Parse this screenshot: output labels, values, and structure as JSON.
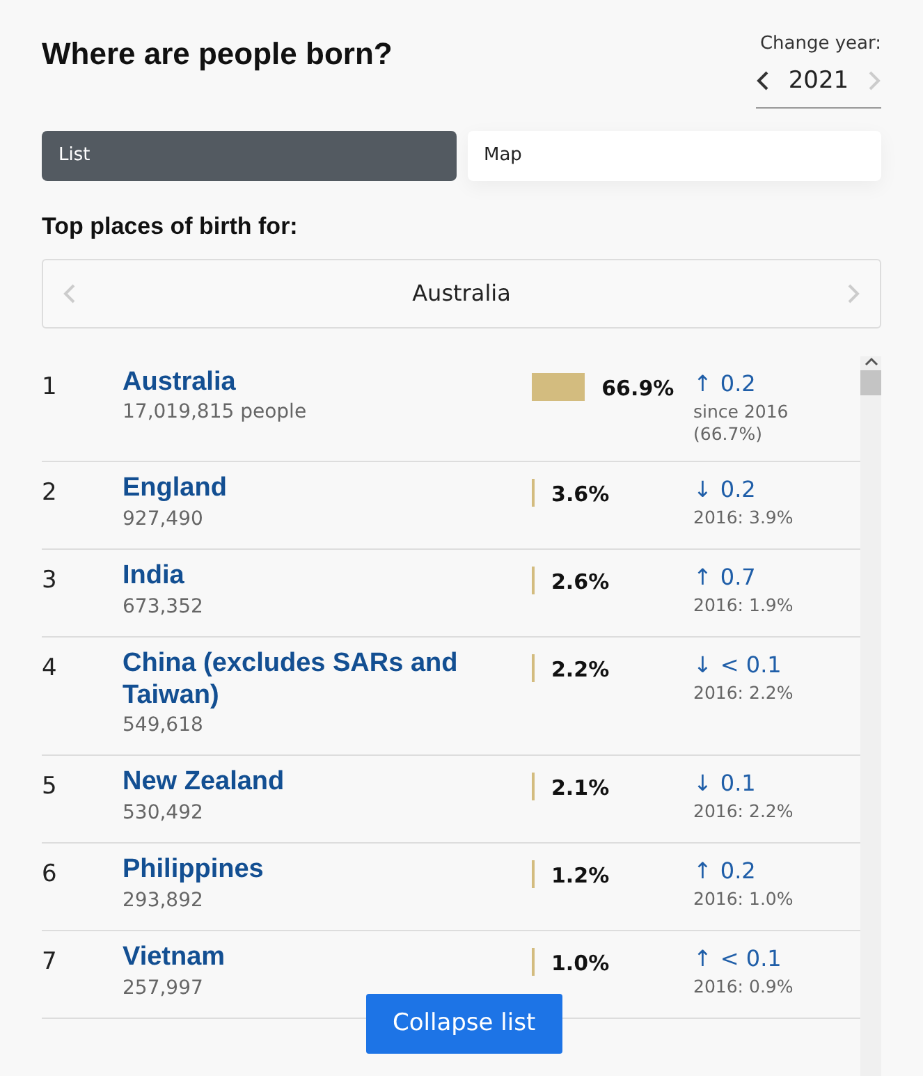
{
  "title": "Where are people born?",
  "year_picker": {
    "label": "Change year:",
    "value": "2021",
    "prev_enabled": true,
    "next_enabled": false
  },
  "tabs": [
    {
      "label": "List",
      "selected": true
    },
    {
      "label": "Map",
      "selected": false
    }
  ],
  "subtitle": "Top places of birth for:",
  "region_picker": {
    "value": "Australia",
    "prev_enabled": false,
    "next_enabled": false
  },
  "rows": [
    {
      "rank": "1",
      "name": "Australia",
      "count": "17,019,815 people",
      "share": "66.9%",
      "arrow": "↑",
      "change": "0.2",
      "previous": "since 2016 (66.7%)"
    },
    {
      "rank": "2",
      "name": "England",
      "count": "927,490",
      "share": "3.6%",
      "arrow": "↓",
      "change": "0.2",
      "previous": "2016: 3.9%"
    },
    {
      "rank": "3",
      "name": "India",
      "count": "673,352",
      "share": "2.6%",
      "arrow": "↑",
      "change": "0.7",
      "previous": "2016: 1.9%"
    },
    {
      "rank": "4",
      "name": "China (excludes SARs and Taiwan)",
      "count": "549,618",
      "share": "2.2%",
      "arrow": "↓",
      "change": "< 0.1",
      "previous": "2016: 2.2%"
    },
    {
      "rank": "5",
      "name": "New Zealand",
      "count": "530,492",
      "share": "2.1%",
      "arrow": "↓",
      "change": "0.1",
      "previous": "2016: 2.2%"
    },
    {
      "rank": "6",
      "name": "Philippines",
      "count": "293,892",
      "share": "1.2%",
      "arrow": "↑",
      "change": "0.2",
      "previous": "2016: 1.0%"
    },
    {
      "rank": "7",
      "name": "Vietnam",
      "count": "257,997",
      "share": "1.0%",
      "arrow": "↑",
      "change": "< 0.1",
      "previous": "2016: 0.9%"
    }
  ],
  "collapse_button": "Collapse list"
}
